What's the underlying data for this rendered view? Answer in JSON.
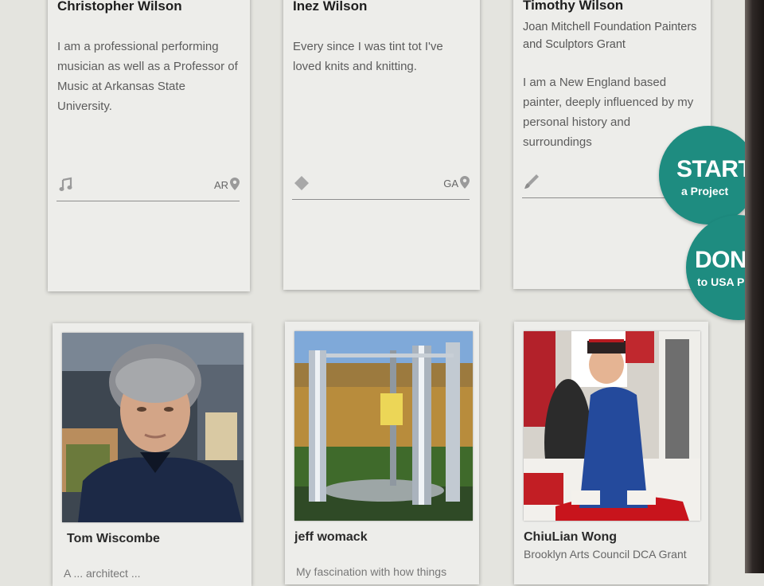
{
  "profiles_row1": [
    {
      "name": "Christopher Wilson",
      "bio": "I am a professional performing musician as well as a Professor of Music at Arkansas State University.",
      "category_icon": "music-note-icon",
      "state": "AR"
    },
    {
      "name": "Inez Wilson",
      "bio": "Every since I was tint tot I've loved knits and knitting.",
      "category_icon": "diamond-icon",
      "state": "GA"
    },
    {
      "name": "Timothy Wilson",
      "subtitle": "Joan Mitchell Foundation Painters and Sculptors Grant",
      "bio": "I am a New England based painter, deeply influenced by my personal history and surroundings",
      "category_icon": "paintbrush-icon",
      "state": ""
    }
  ],
  "profiles_row2": [
    {
      "name": "Tom Wiscombe",
      "cutoff_text": "A ... architect ...",
      "photo": "portrait-photo"
    },
    {
      "name": "jeff womack",
      "cutoff_text": "My fascination with how things",
      "photo": "sculpture-photo"
    },
    {
      "name": "ChiuLian Wong",
      "subtitle": "Brooklyn Arts Council DCA Grant",
      "photo": "artist-photo"
    }
  ],
  "start_button": {
    "big": "START",
    "small": "a Project"
  },
  "donate_button": {
    "big": "DONATE",
    "small": "to USA Projects"
  },
  "colors": {
    "accent": "#1e8c80",
    "card": "#ededea",
    "background": "#e4e4df"
  }
}
